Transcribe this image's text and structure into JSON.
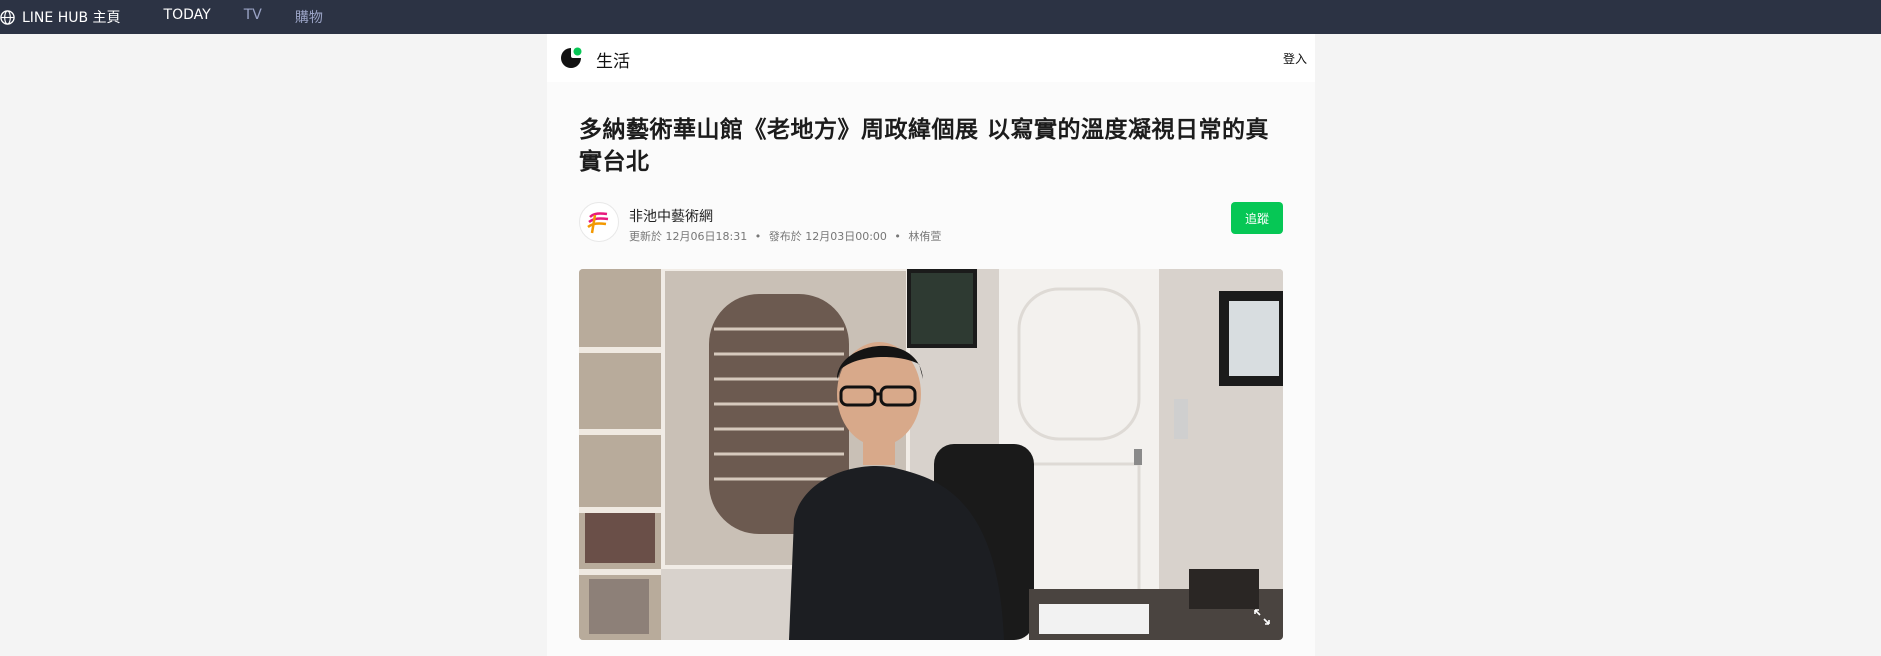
{
  "topbar": {
    "brand_label": "LINE HUB 主頁",
    "tabs": [
      {
        "label": "TODAY",
        "active": true
      },
      {
        "label": "TV",
        "active": false
      },
      {
        "label": "購物",
        "active": false
      }
    ]
  },
  "section": {
    "title": "生活",
    "login_label": "登入"
  },
  "article": {
    "title": "多納藝術華山館《老地方》周政緯個展 以寫實的溫度凝視日常的真實台北",
    "publisher": {
      "name": "非池中藝術網",
      "updated": "更新於 12月06日18:31",
      "published": "發布於 12月03日00:00",
      "author": "林侑萱",
      "separator": "•"
    },
    "follow_label": "追蹤"
  },
  "colors": {
    "topbar_bg": "#2c3344",
    "accent_green": "#06c755",
    "inactive_tab": "#9aa3c5"
  },
  "icons": {
    "globe": "globe-icon",
    "section_logo": "line-today-logo",
    "expand": "expand-icon"
  }
}
